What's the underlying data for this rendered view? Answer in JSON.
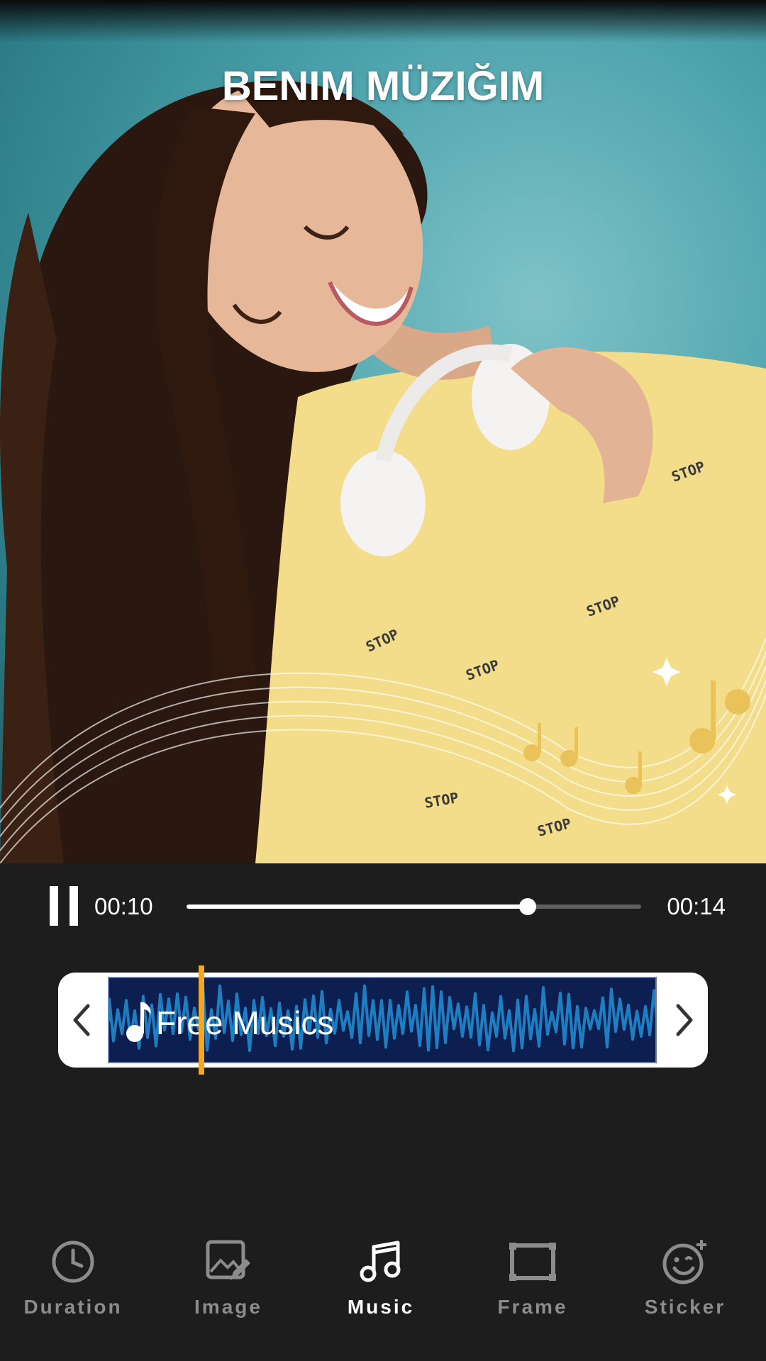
{
  "video": {
    "title": "BENIM MÜZIĞIM"
  },
  "player": {
    "state": "paused-control-shown",
    "current_time": "00:10",
    "total_time": "00:14",
    "progress_fraction": 0.75
  },
  "music_track": {
    "name": "Free Musics",
    "playhead_fraction": 0.17,
    "track_color": "#0d1f50",
    "wave_color": "#1d7fc1",
    "playhead_color": "#f5a623"
  },
  "bottom_nav": {
    "items": [
      {
        "label": "Duration",
        "icon": "clock-icon",
        "active": false
      },
      {
        "label": "Image",
        "icon": "image-edit-icon",
        "active": false
      },
      {
        "label": "Music",
        "icon": "music-note-icon",
        "active": true
      },
      {
        "label": "Frame",
        "icon": "frame-icon",
        "active": false
      },
      {
        "label": "Sticker",
        "icon": "sticker-icon",
        "active": false
      }
    ]
  }
}
